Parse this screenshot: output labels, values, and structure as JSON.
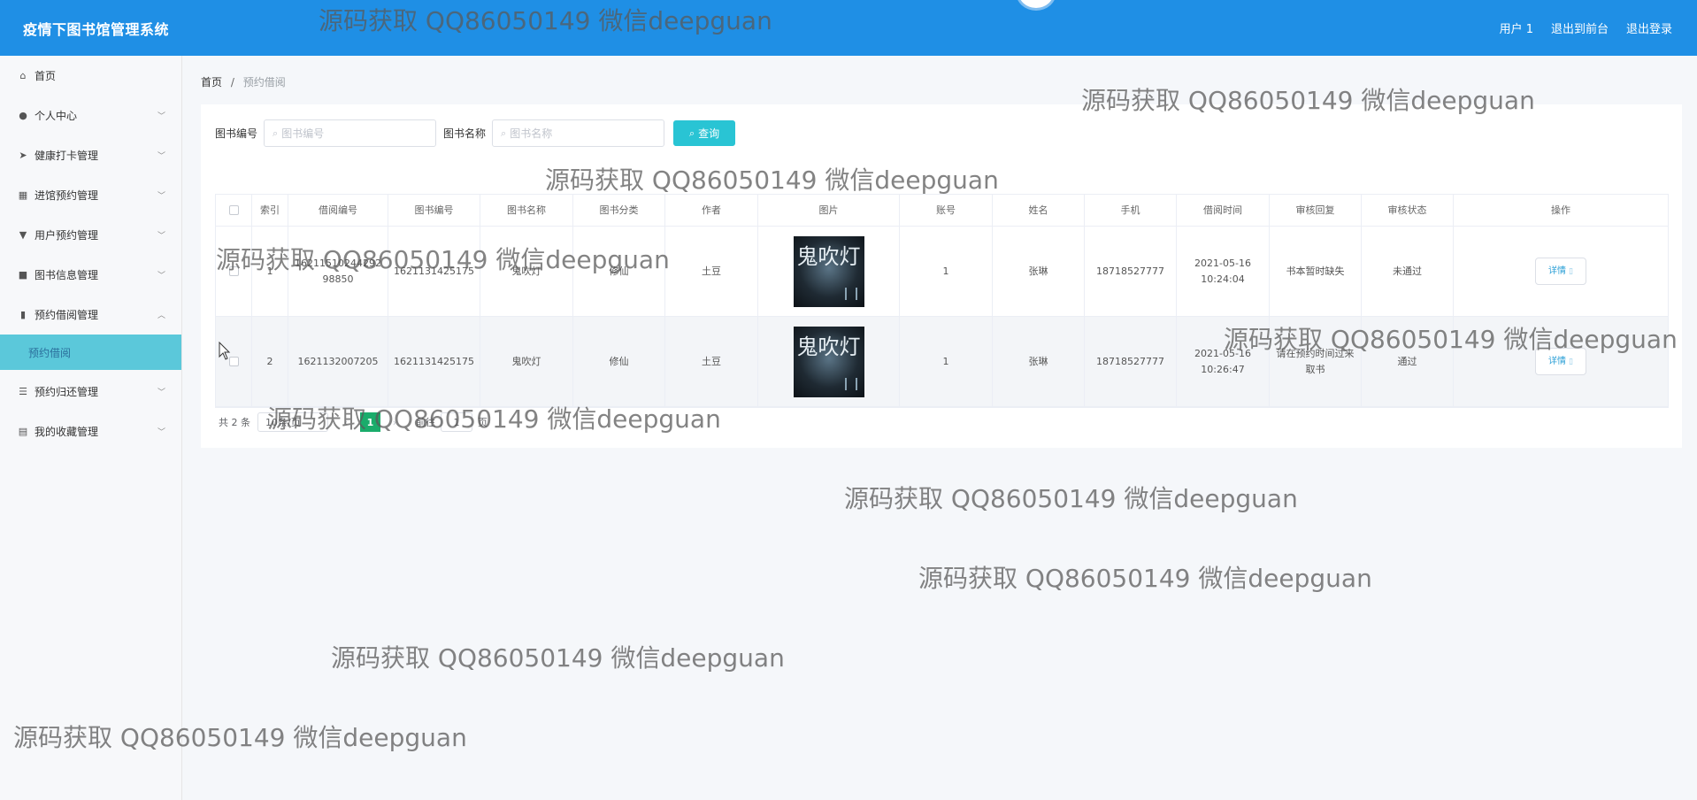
{
  "header": {
    "brand": "疫情下图书馆管理系统",
    "links": [
      "用户 1",
      "退出到前台",
      "退出登录"
    ]
  },
  "sidebar": {
    "items": [
      {
        "label": "首页",
        "icon": "home-icon",
        "has_children": false
      },
      {
        "label": "个人中心",
        "icon": "user-icon",
        "has_children": true
      },
      {
        "label": "健康打卡管理",
        "icon": "send-icon",
        "has_children": true
      },
      {
        "label": "进馆预约管理",
        "icon": "grid-icon",
        "has_children": true
      },
      {
        "label": "用户预约管理",
        "icon": "pin-icon",
        "has_children": true
      },
      {
        "label": "图书信息管理",
        "icon": "briefcase-icon",
        "has_children": true
      },
      {
        "label": "预约借阅管理",
        "icon": "chart-icon",
        "has_children": true,
        "expanded": true
      },
      {
        "label": "预约归还管理",
        "icon": "list-icon",
        "has_children": true
      },
      {
        "label": "我的收藏管理",
        "icon": "clipboard-icon",
        "has_children": true
      }
    ],
    "active_sub": "预约借阅"
  },
  "breadcrumb": {
    "home": "首页",
    "sep": "/",
    "current": "预约借阅"
  },
  "search": {
    "book_no_label": "图书编号",
    "book_no_placeholder": "图书编号",
    "book_name_label": "图书名称",
    "book_name_placeholder": "图书名称",
    "query_label": "查询"
  },
  "table": {
    "headers": [
      "索引",
      "借阅编号",
      "图书编号",
      "图书名称",
      "图书分类",
      "作者",
      "图片",
      "账号",
      "姓名",
      "手机",
      "借阅时间",
      "审核回复",
      "审核状态",
      "操作"
    ],
    "rows": [
      {
        "index": "1",
        "borrow_no": "1621151024429298850",
        "book_no": "1621131425175",
        "book_name": "鬼吹灯",
        "category": "修仙",
        "author": "土豆",
        "cover_title": "鬼吹灯",
        "account": "1",
        "name": "张琳",
        "phone": "18718527777",
        "time": "2021-05-16 10:24:04",
        "reply": "书本暂时缺失",
        "status": "未通过",
        "action": "详情"
      },
      {
        "index": "2",
        "borrow_no": "1621132007205",
        "book_no": "1621131425175",
        "book_name": "鬼吹灯",
        "category": "修仙",
        "author": "土豆",
        "cover_title": "鬼吹灯",
        "account": "1",
        "name": "张琳",
        "phone": "18718527777",
        "time": "2021-05-16 10:26:47",
        "reply": "请在预约时间过来取书",
        "status": "通过",
        "action": "详情"
      }
    ]
  },
  "pager": {
    "total": "共 2 条",
    "size": "10条/页",
    "page": "1",
    "goto_prefix": "前往",
    "goto_value": "1",
    "goto_suffix": "页"
  },
  "watermark": "源码获取 QQ86050149 微信deepguan"
}
